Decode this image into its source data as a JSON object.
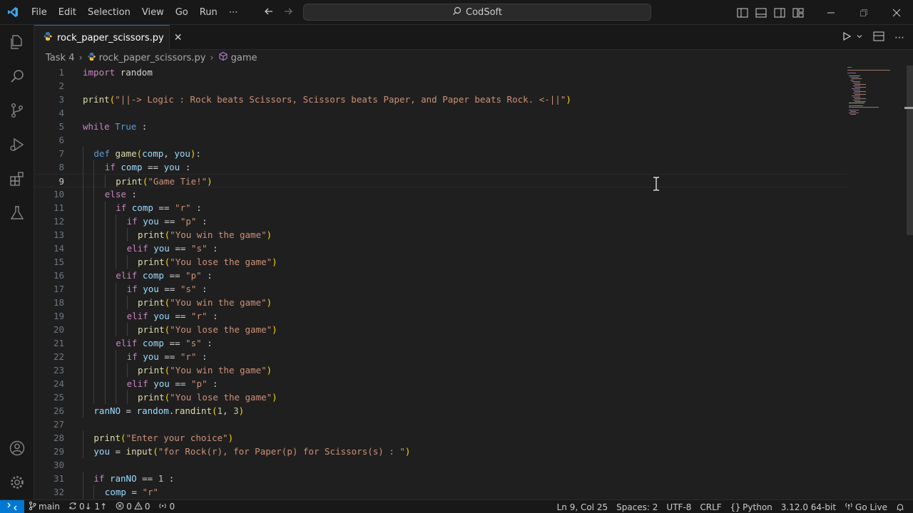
{
  "titlebar": {
    "menu": [
      "File",
      "Edit",
      "Selection",
      "View",
      "Go",
      "Run",
      "⋯"
    ],
    "command_center": "CodSoft",
    "window_controls": [
      "minimize",
      "restore",
      "close"
    ]
  },
  "activitybar": {
    "top": [
      "explorer-icon",
      "search-icon",
      "source-control-icon",
      "run-debug-icon",
      "extensions-icon",
      "testing-icon"
    ],
    "bottom": [
      "accounts-icon",
      "settings-gear-icon"
    ]
  },
  "tab": {
    "label": "rock_paper_scissors.py",
    "close": "✕"
  },
  "breadcrumb": {
    "folder": "Task 4",
    "file": "rock_paper_scissors.py",
    "symbol": "game"
  },
  "editor": {
    "current_line": 9,
    "lines": [
      {
        "n": "1",
        "indent": 0,
        "t": [
          [
            "k",
            "import"
          ],
          [
            "p",
            " "
          ],
          [
            "p",
            "random"
          ]
        ]
      },
      {
        "n": "2",
        "indent": 0,
        "t": []
      },
      {
        "n": "3",
        "indent": 0,
        "t": [
          [
            "f",
            "print"
          ],
          [
            "br1",
            "("
          ],
          [
            "s",
            "\"||-> Logic : Rock beats Scissors, Scissors beats Paper, and Paper beats Rock. <-||\""
          ],
          [
            "br1",
            ")"
          ]
        ]
      },
      {
        "n": "4",
        "indent": 0,
        "t": []
      },
      {
        "n": "5",
        "indent": 0,
        "t": [
          [
            "k",
            "while"
          ],
          [
            "p",
            " "
          ],
          [
            "kb",
            "True"
          ],
          [
            "p",
            " :"
          ]
        ]
      },
      {
        "n": "6",
        "indent": 0,
        "t": []
      },
      {
        "n": "7",
        "indent": 1,
        "t": [
          [
            "kb",
            "def"
          ],
          [
            "p",
            " "
          ],
          [
            "f",
            "game"
          ],
          [
            "br1",
            "("
          ],
          [
            "v",
            "comp"
          ],
          [
            "p",
            ", "
          ],
          [
            "v",
            "you"
          ],
          [
            "br1",
            ")"
          ],
          [
            "p",
            ":"
          ]
        ]
      },
      {
        "n": "8",
        "indent": 2,
        "t": [
          [
            "k",
            "if"
          ],
          [
            "p",
            " "
          ],
          [
            "v",
            "comp"
          ],
          [
            "p",
            " == "
          ],
          [
            "v",
            "you"
          ],
          [
            "p",
            " :"
          ]
        ]
      },
      {
        "n": "9",
        "indent": 3,
        "t": [
          [
            "f",
            "print"
          ],
          [
            "br1",
            "("
          ],
          [
            "s",
            "\"Game Tie!\""
          ],
          [
            "br1",
            ")"
          ]
        ]
      },
      {
        "n": "10",
        "indent": 2,
        "t": [
          [
            "k",
            "else"
          ],
          [
            "p",
            " :"
          ]
        ]
      },
      {
        "n": "11",
        "indent": 3,
        "t": [
          [
            "k",
            "if"
          ],
          [
            "p",
            " "
          ],
          [
            "v",
            "comp"
          ],
          [
            "p",
            " == "
          ],
          [
            "s",
            "\"r\""
          ],
          [
            "p",
            " :"
          ]
        ]
      },
      {
        "n": "12",
        "indent": 4,
        "t": [
          [
            "k",
            "if"
          ],
          [
            "p",
            " "
          ],
          [
            "v",
            "you"
          ],
          [
            "p",
            " == "
          ],
          [
            "s",
            "\"p\""
          ],
          [
            "p",
            " :"
          ]
        ]
      },
      {
        "n": "13",
        "indent": 5,
        "t": [
          [
            "f",
            "print"
          ],
          [
            "br1",
            "("
          ],
          [
            "s",
            "\"You win the game\""
          ],
          [
            "br1",
            ")"
          ]
        ]
      },
      {
        "n": "14",
        "indent": 4,
        "t": [
          [
            "k",
            "elif"
          ],
          [
            "p",
            " "
          ],
          [
            "v",
            "you"
          ],
          [
            "p",
            " == "
          ],
          [
            "s",
            "\"s\""
          ],
          [
            "p",
            " :"
          ]
        ]
      },
      {
        "n": "15",
        "indent": 5,
        "t": [
          [
            "f",
            "print"
          ],
          [
            "br1",
            "("
          ],
          [
            "s",
            "\"You lose the game\""
          ],
          [
            "br1",
            ")"
          ]
        ]
      },
      {
        "n": "16",
        "indent": 3,
        "t": [
          [
            "k",
            "elif"
          ],
          [
            "p",
            " "
          ],
          [
            "v",
            "comp"
          ],
          [
            "p",
            " == "
          ],
          [
            "s",
            "\"p\""
          ],
          [
            "p",
            " :"
          ]
        ]
      },
      {
        "n": "17",
        "indent": 4,
        "t": [
          [
            "k",
            "if"
          ],
          [
            "p",
            " "
          ],
          [
            "v",
            "you"
          ],
          [
            "p",
            " == "
          ],
          [
            "s",
            "\"s\""
          ],
          [
            "p",
            " :"
          ]
        ]
      },
      {
        "n": "18",
        "indent": 5,
        "t": [
          [
            "f",
            "print"
          ],
          [
            "br1",
            "("
          ],
          [
            "s",
            "\"You win the game\""
          ],
          [
            "br1",
            ")"
          ]
        ]
      },
      {
        "n": "19",
        "indent": 4,
        "t": [
          [
            "k",
            "elif"
          ],
          [
            "p",
            " "
          ],
          [
            "v",
            "you"
          ],
          [
            "p",
            " == "
          ],
          [
            "s",
            "\"r\""
          ],
          [
            "p",
            " :"
          ]
        ]
      },
      {
        "n": "20",
        "indent": 5,
        "t": [
          [
            "f",
            "print"
          ],
          [
            "br1",
            "("
          ],
          [
            "s",
            "\"You lose the game\""
          ],
          [
            "br1",
            ")"
          ]
        ]
      },
      {
        "n": "21",
        "indent": 3,
        "t": [
          [
            "k",
            "elif"
          ],
          [
            "p",
            " "
          ],
          [
            "v",
            "comp"
          ],
          [
            "p",
            " == "
          ],
          [
            "s",
            "\"s\""
          ],
          [
            "p",
            " :"
          ]
        ]
      },
      {
        "n": "22",
        "indent": 4,
        "t": [
          [
            "k",
            "if"
          ],
          [
            "p",
            " "
          ],
          [
            "v",
            "you"
          ],
          [
            "p",
            " == "
          ],
          [
            "s",
            "\"r\""
          ],
          [
            "p",
            " :"
          ]
        ]
      },
      {
        "n": "23",
        "indent": 5,
        "t": [
          [
            "f",
            "print"
          ],
          [
            "br1",
            "("
          ],
          [
            "s",
            "\"You win the game\""
          ],
          [
            "br1",
            ")"
          ]
        ]
      },
      {
        "n": "24",
        "indent": 4,
        "t": [
          [
            "k",
            "elif"
          ],
          [
            "p",
            " "
          ],
          [
            "v",
            "you"
          ],
          [
            "p",
            " == "
          ],
          [
            "s",
            "\"p\""
          ],
          [
            "p",
            " :"
          ]
        ]
      },
      {
        "n": "25",
        "indent": 5,
        "t": [
          [
            "f",
            "print"
          ],
          [
            "br1",
            "("
          ],
          [
            "s",
            "\"You lose the game\""
          ],
          [
            "br1",
            ")"
          ]
        ]
      },
      {
        "n": "26",
        "indent": 1,
        "t": [
          [
            "v",
            "ranNO"
          ],
          [
            "p",
            " = "
          ],
          [
            "v",
            "random"
          ],
          [
            "p",
            "."
          ],
          [
            "f",
            "randint"
          ],
          [
            "br1",
            "("
          ],
          [
            "n",
            "1"
          ],
          [
            "p",
            ", "
          ],
          [
            "n",
            "3"
          ],
          [
            "br1",
            ")"
          ]
        ]
      },
      {
        "n": "27",
        "indent": 0,
        "t": []
      },
      {
        "n": "28",
        "indent": 1,
        "t": [
          [
            "f",
            "print"
          ],
          [
            "br1",
            "("
          ],
          [
            "s",
            "\"Enter your choice\""
          ],
          [
            "br1",
            ")"
          ]
        ]
      },
      {
        "n": "29",
        "indent": 1,
        "t": [
          [
            "v",
            "you"
          ],
          [
            "p",
            " = "
          ],
          [
            "f",
            "input"
          ],
          [
            "br1",
            "("
          ],
          [
            "s",
            "\"for Rock(r), for Paper(p) for Scissors(s) : \""
          ],
          [
            "br1",
            ")"
          ]
        ]
      },
      {
        "n": "30",
        "indent": 0,
        "t": []
      },
      {
        "n": "31",
        "indent": 1,
        "t": [
          [
            "k",
            "if"
          ],
          [
            "p",
            " "
          ],
          [
            "v",
            "ranNO"
          ],
          [
            "p",
            " == "
          ],
          [
            "n",
            "1"
          ],
          [
            "p",
            " :"
          ]
        ]
      },
      {
        "n": "32",
        "indent": 2,
        "t": [
          [
            "v",
            "comp"
          ],
          [
            "p",
            " = "
          ],
          [
            "s",
            "\"r\""
          ]
        ]
      }
    ]
  },
  "statusbar": {
    "branch": "main",
    "sync": "0↓ 1↑",
    "errors": "0",
    "warnings": "0",
    "ports": "0",
    "position": "Ln 9, Col 25",
    "spaces": "Spaces: 2",
    "encoding": "UTF-8",
    "eol": "CRLF",
    "language": "Python",
    "interpreter": "3.12.0 64-bit",
    "live": "Go Live"
  },
  "colors": {
    "accent": "#0078d4",
    "keyword": "#c586c0",
    "storage": "#569cd6",
    "function": "#dcdcaa",
    "variable": "#9cdcfe",
    "string": "#ce9178",
    "number": "#b5cea8",
    "bracket": "#ffd700"
  }
}
